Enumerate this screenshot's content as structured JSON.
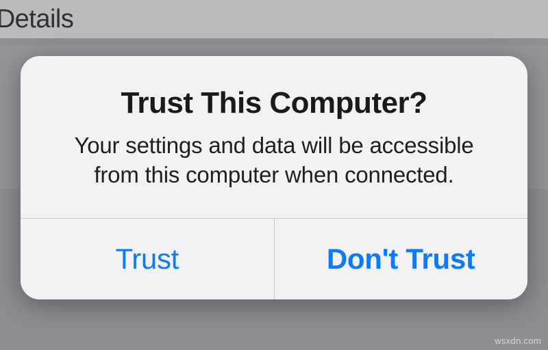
{
  "background": {
    "header_text": "e Details"
  },
  "alert": {
    "title": "Trust This Computer?",
    "message": "Your settings and data will be accessible from this computer when connected.",
    "buttons": {
      "trust": "Trust",
      "dont_trust": "Don't Trust"
    }
  },
  "watermark": "wsxdn.com"
}
